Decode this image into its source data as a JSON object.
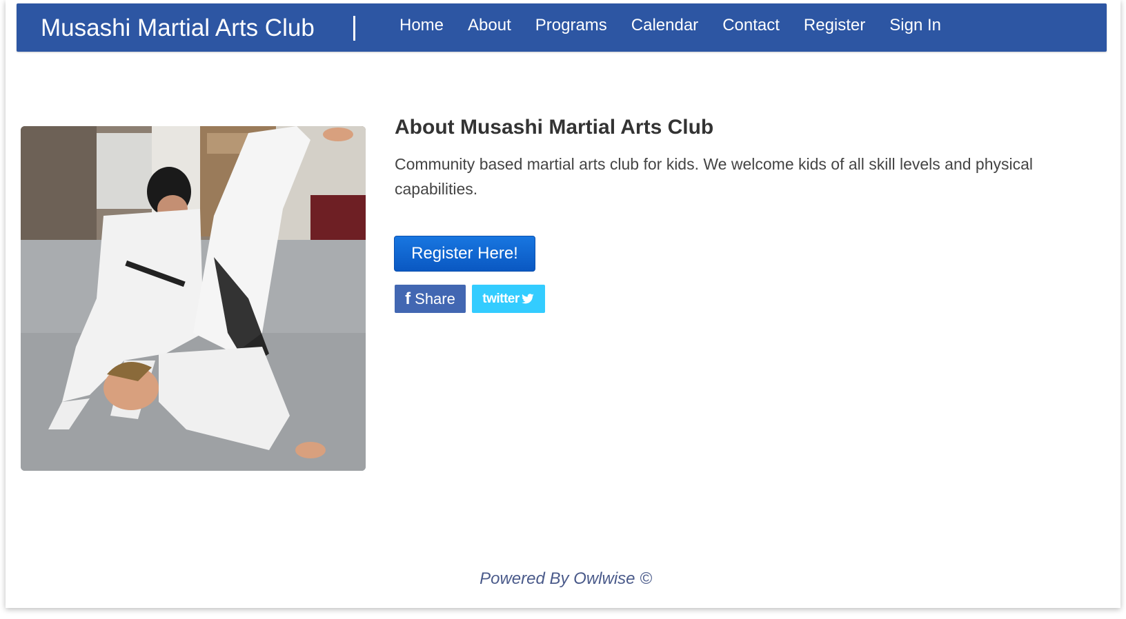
{
  "header": {
    "brand": "Musashi Martial Arts Club",
    "nav": [
      {
        "label": "Home"
      },
      {
        "label": "About"
      },
      {
        "label": "Programs"
      },
      {
        "label": "Calendar"
      },
      {
        "label": "Contact"
      },
      {
        "label": "Register"
      },
      {
        "label": "Sign In"
      }
    ]
  },
  "main": {
    "image": "judo-throw-photo",
    "about_title": "About Musashi Martial Arts Club",
    "about_text": "Community based martial arts club for kids.  We welcome kids of all skill levels and physical capabilities.",
    "register_button": "Register Here!",
    "share": {
      "facebook_label": "Share",
      "twitter_label": "twitter"
    }
  },
  "footer": {
    "powered_by": "Powered By Owlwise ©"
  },
  "colors": {
    "navbar": "#2d56a3",
    "register_button": "#0a58c2",
    "facebook": "#4267b2",
    "twitter": "#33ccff"
  }
}
